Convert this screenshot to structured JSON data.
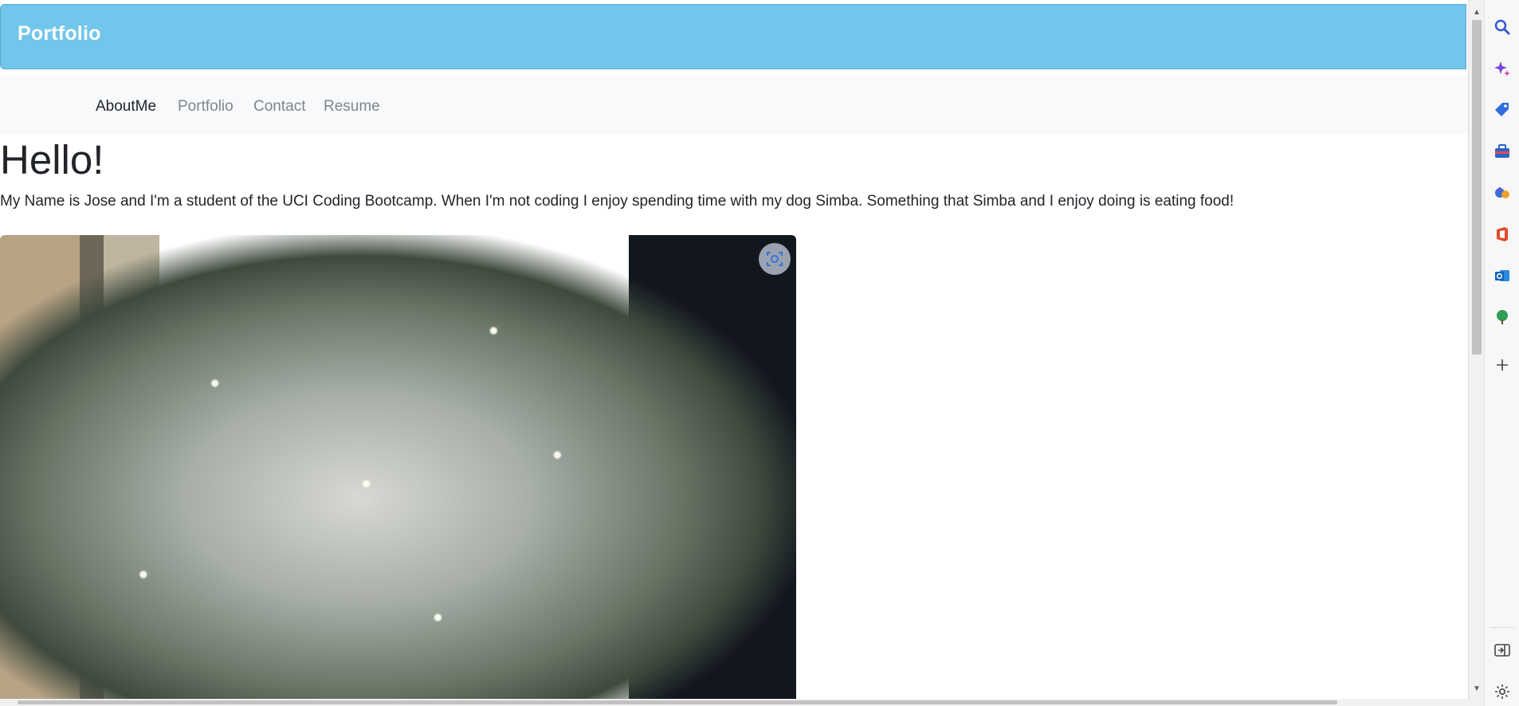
{
  "header": {
    "brand": "Portfolio"
  },
  "nav": {
    "items": [
      {
        "label": "AboutMe",
        "active": true
      },
      {
        "label": "Portfolio",
        "active": false
      },
      {
        "label": "Contact",
        "active": false
      },
      {
        "label": "Resume",
        "active": false
      }
    ]
  },
  "main": {
    "heading": "Hello!",
    "intro": "My Name is Jose and I'm a student of the UCI Coding Bootcamp. When I'm not coding I enjoy spending time with my dog Simba. Something that Simba and I enjoy doing is eating food!"
  },
  "photo": {
    "subject": "christmas-tree-photo"
  },
  "browser_sidebar": {
    "icons": [
      "search-icon",
      "copilot-icon",
      "shopping-tag-icon",
      "toolbox-icon",
      "games-icon",
      "office-icon",
      "outlook-icon",
      "tree-icon",
      "add-icon",
      "split-screen-icon",
      "settings-icon"
    ]
  },
  "colors": {
    "header_bg": "#72c6eb",
    "navbar_bg": "#f8f9fa",
    "nav_active": "#212529",
    "nav_inactive": "#80858a"
  }
}
